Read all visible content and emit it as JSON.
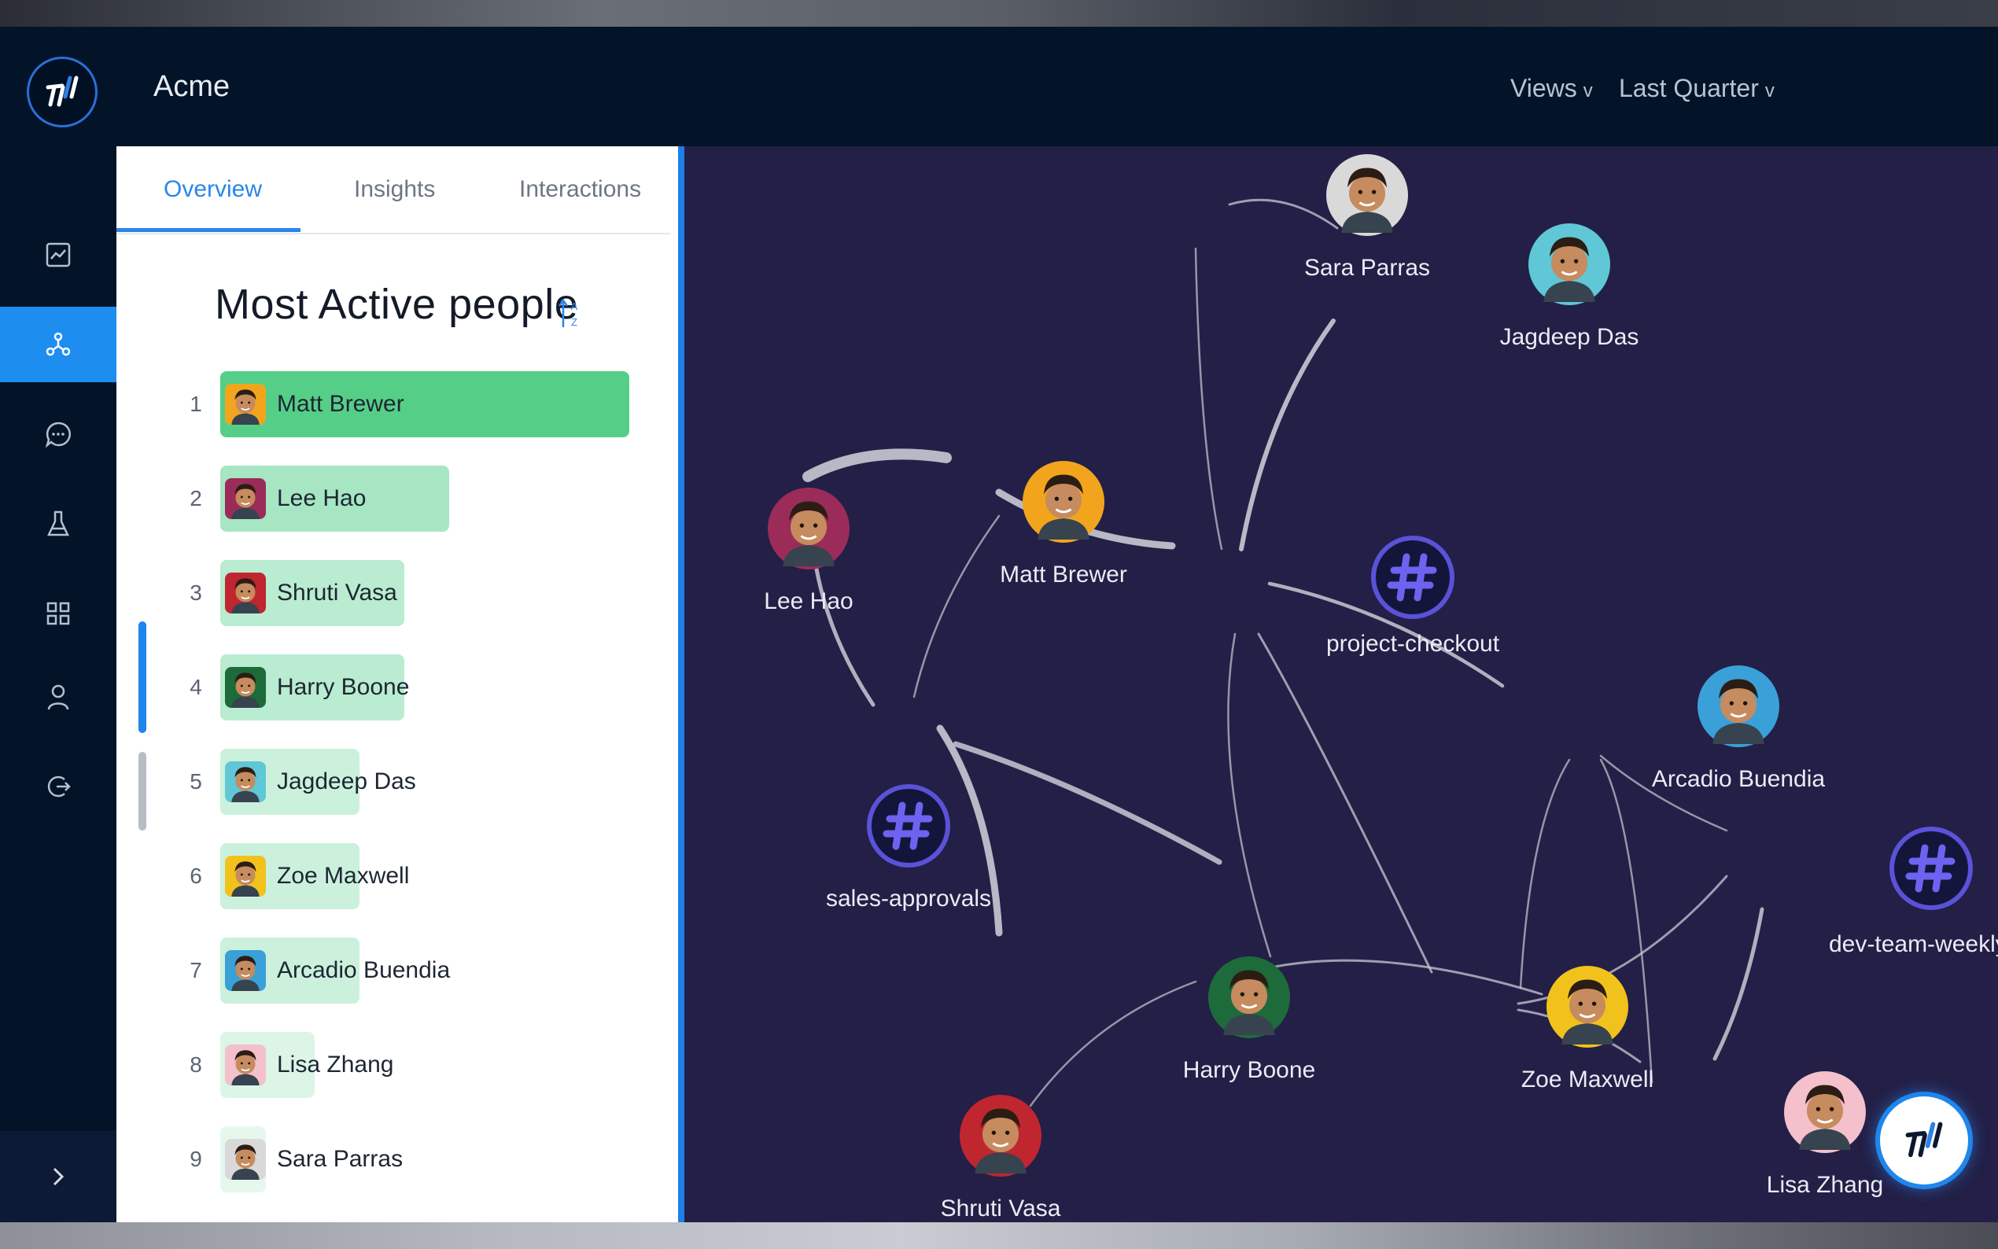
{
  "app": {
    "title": "Acme"
  },
  "header": {
    "views_label": "Views",
    "period_label": "Last Quarter",
    "chevron": "v"
  },
  "nav": {
    "items": [
      {
        "icon": "line-chart-icon",
        "active": false
      },
      {
        "icon": "network-graph-icon",
        "active": true
      },
      {
        "icon": "chat-bubble-icon",
        "active": false
      },
      {
        "icon": "flask-icon",
        "active": false
      },
      {
        "icon": "grid-icon",
        "active": false
      },
      {
        "icon": "user-icon",
        "active": false
      },
      {
        "icon": "logout-icon",
        "active": false
      }
    ],
    "collapse_icon": "chevron-right-icon"
  },
  "panel": {
    "tabs": [
      "Overview",
      "Insights",
      "Interactions"
    ],
    "active_tab": "Overview",
    "title": "Most Active people",
    "sort_icon": "sort-alpha-icon",
    "people": [
      {
        "rank": "1",
        "name": "Matt Brewer",
        "activity": 1.0,
        "color": "#55cf88"
      },
      {
        "rank": "2",
        "name": "Lee Hao",
        "activity": 0.56,
        "color": "#a6e6c3"
      },
      {
        "rank": "3",
        "name": "Shruti Vasa",
        "activity": 0.45,
        "color": "#b9ecd0"
      },
      {
        "rank": "4",
        "name": "Harry Boone",
        "activity": 0.45,
        "color": "#b9ecd0"
      },
      {
        "rank": "5",
        "name": "Jagdeep Das",
        "activity": 0.34,
        "color": "#cbf1dc"
      },
      {
        "rank": "6",
        "name": "Zoe Maxwell",
        "activity": 0.34,
        "color": "#cbf1dc"
      },
      {
        "rank": "7",
        "name": "Arcadio Buendia",
        "activity": 0.34,
        "color": "#cbf1dc"
      },
      {
        "rank": "8",
        "name": "Lisa Zhang",
        "activity": 0.23,
        "color": "#dcf5e7"
      },
      {
        "rank": "9",
        "name": "Sara Parras",
        "activity": 0.11,
        "color": "#e6f8ee"
      }
    ]
  },
  "graph": {
    "people_nodes": [
      {
        "name": "Sara Parras",
        "color": "#d9d9d9"
      },
      {
        "name": "Jagdeep Das",
        "color": "#5fc7d6"
      },
      {
        "name": "Lee Hao",
        "color": "#9b2c5a"
      },
      {
        "name": "Matt Brewer",
        "color": "#f2a51c"
      },
      {
        "name": "Arcadio Buendia",
        "color": "#3aa0d8"
      },
      {
        "name": "Harry Boone",
        "color": "#1d6b3a"
      },
      {
        "name": "Zoe Maxwell",
        "color": "#f2c21c"
      },
      {
        "name": "Lisa Zhang",
        "color": "#f3c0cc"
      },
      {
        "name": "Shruti Vasa",
        "color": "#c0262f"
      }
    ],
    "channel_nodes": [
      {
        "name": "project-checkout"
      },
      {
        "name": "sales-approvals"
      },
      {
        "name": "dev-team-weekly"
      }
    ],
    "hash_icon": "hashtag-icon"
  },
  "fab": {
    "icon": "app-logo-icon"
  }
}
